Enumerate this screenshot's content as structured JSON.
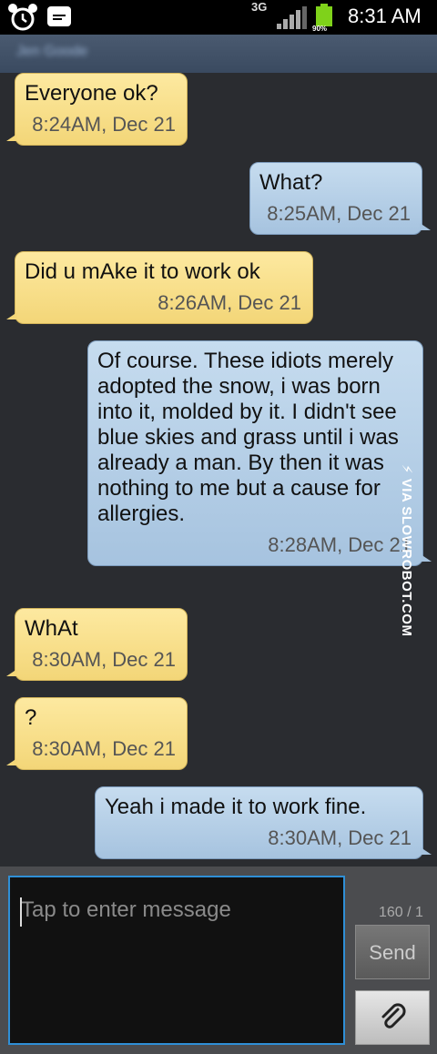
{
  "status_bar": {
    "network": "3G",
    "battery": "90%",
    "time": "8:31 AM"
  },
  "header": {
    "contact_name": "Jen Goode"
  },
  "messages": [
    {
      "direction": "in",
      "text": "Everyone ok?",
      "time": "8:24AM, Dec 21"
    },
    {
      "direction": "out",
      "text": "What?",
      "time": "8:25AM, Dec 21"
    },
    {
      "direction": "in",
      "text": "Did u mAke it to work ok",
      "time": "8:26AM, Dec 21"
    },
    {
      "direction": "out",
      "text": "Of course. These idiots merely adopted the snow, i was born into it, molded by it. I didn't see blue skies and grass until i was already a man. By then it was nothing to me but a cause for allergies.",
      "time": "8:28AM, Dec 21"
    },
    {
      "direction": "in",
      "text": "WhAt",
      "time": "8:30AM, Dec 21"
    },
    {
      "direction": "in",
      "text": "?",
      "time": "8:30AM, Dec 21"
    },
    {
      "direction": "out",
      "text": "Yeah i made it to work fine.",
      "time": "8:30AM, Dec 21"
    }
  ],
  "watermark": "⚡ VIA SLOWROBOT.COM",
  "composer": {
    "placeholder": "Tap to enter message",
    "counter": "160 / 1",
    "send_label": "Send"
  },
  "icons": {
    "alarm": "alarm-clock-icon",
    "message": "message-notification-icon",
    "signal": "signal-strength-icon",
    "battery": "battery-icon",
    "attach": "paperclip-icon"
  },
  "colors": {
    "incoming_bubble": "#f3d678",
    "outgoing_bubble": "#a6c3df",
    "input_border": "#2f8fd6"
  }
}
